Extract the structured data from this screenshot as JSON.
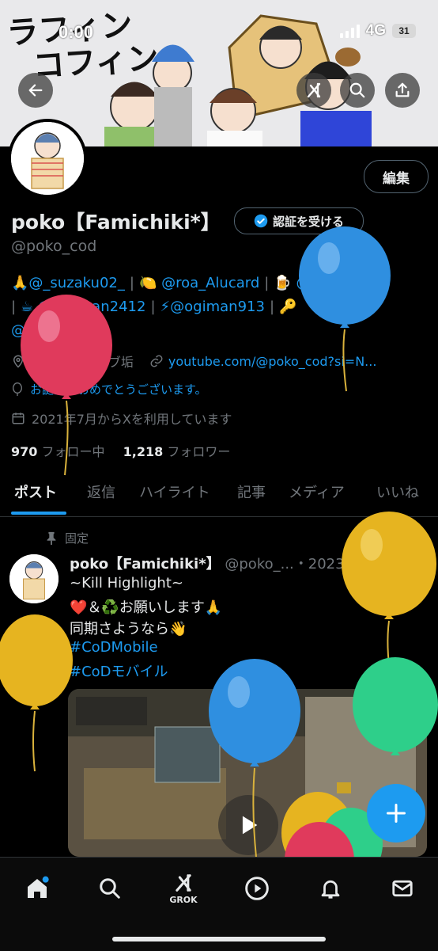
{
  "status_bar": {
    "time": "0:00",
    "network": "4G",
    "battery": "31"
  },
  "banner": {
    "title_line1": "ラフィン",
    "title_line2": "コフィン"
  },
  "header": {
    "back_icon": "arrow-left-icon",
    "grok_icon": "grok-icon",
    "search_icon": "search-icon",
    "share_icon": "share-icon"
  },
  "profile": {
    "edit_label": "編集",
    "display_name": "poko【Famichiki*】",
    "verify_label": "認証を受ける",
    "handle": "@poko_cod",
    "bio_line1": [
      "🙏@_suzaku02_",
      "🍋 @roa_Alucard",
      "🍺 @riri_lily11"
    ],
    "bio_line2": [
      "☕ @yaaman2412",
      "⚡@ogiman913",
      "🔑"
    ],
    "bio_line3": "@p_k_o_o_",
    "location": "@Cx7zr のサブ垢",
    "link": "youtube.com/@poko_cod?si=N...",
    "birthday": "お誕生日おめでとうございます。",
    "joined": "2021年7月からXを利用しています",
    "following_count": "970",
    "following_label": "フォロー中",
    "followers_count": "1,218",
    "followers_label": "フォロワー"
  },
  "tabs": [
    "ポスト",
    "返信",
    "ハイライト",
    "記事",
    "メディア",
    "いいね"
  ],
  "post": {
    "pinned_label": "固定",
    "author_name": "poko【Famichiki*】",
    "author_handle": "@poko_...",
    "date": "・2023/04/08",
    "line1": "~Kill Highlight~",
    "line2": "❤️＆♻️お願いします🙏",
    "line3": "同期さようなら👋",
    "hashtag1": "#CoDMobile",
    "hashtag2": "#CoDモバイル"
  },
  "bottom_nav": {
    "grok_label": "GROK"
  },
  "colors": {
    "accent": "#1d9bf0",
    "muted": "#71767b",
    "text": "#e7e9ea",
    "background": "#000000"
  }
}
